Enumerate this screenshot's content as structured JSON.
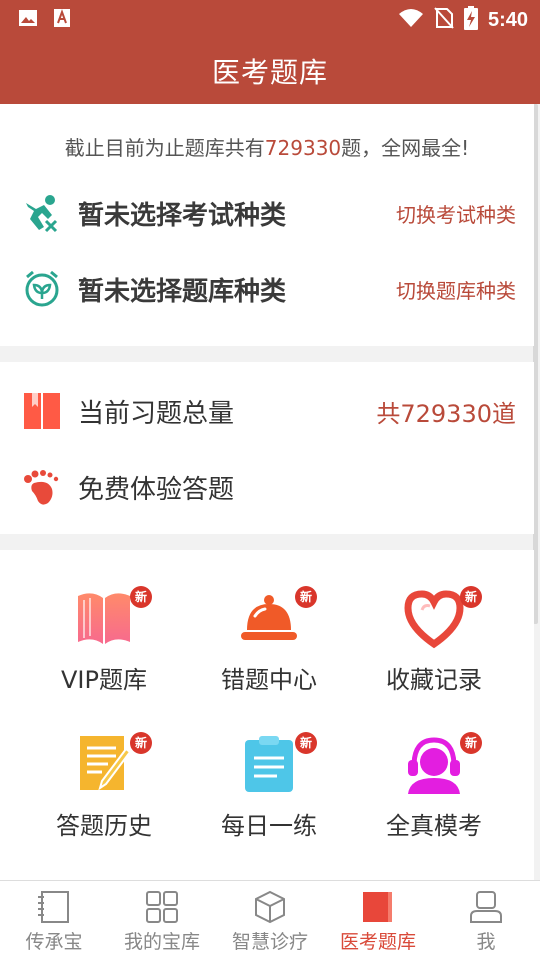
{
  "status_bar": {
    "time": "5:40"
  },
  "app": {
    "title": "医考题库"
  },
  "summary": {
    "prefix": "截止目前为止题库共有",
    "count": "729330",
    "suffix": "题，全网最全!"
  },
  "exam_type": {
    "label": "暂未选择考试种类",
    "action": "切换考试种类"
  },
  "bank_type": {
    "label": "暂未选择题库种类",
    "action": "切换题库种类"
  },
  "total": {
    "label": "当前习题总量",
    "value": "共729330道"
  },
  "free_trial": {
    "label": "免费体验答题"
  },
  "badge_label": "新",
  "grid": [
    {
      "label": "VIP题库",
      "icon": "book-icon"
    },
    {
      "label": "错题中心",
      "icon": "service-bell-icon"
    },
    {
      "label": "收藏记录",
      "icon": "heart-icon"
    },
    {
      "label": "答题历史",
      "icon": "notepad-pencil-icon"
    },
    {
      "label": "每日一练",
      "icon": "clipboard-icon"
    },
    {
      "label": "全真模考",
      "icon": "headset-user-icon"
    }
  ],
  "tabs": [
    {
      "label": "传承宝"
    },
    {
      "label": "我的宝库"
    },
    {
      "label": "智慧诊疗"
    },
    {
      "label": "医考题库",
      "active": true
    },
    {
      "label": "我"
    }
  ],
  "colors": {
    "primary": "#b94a3a",
    "accent": "#d94a3a",
    "badge": "#d9362b",
    "teal": "#2aa58f"
  }
}
